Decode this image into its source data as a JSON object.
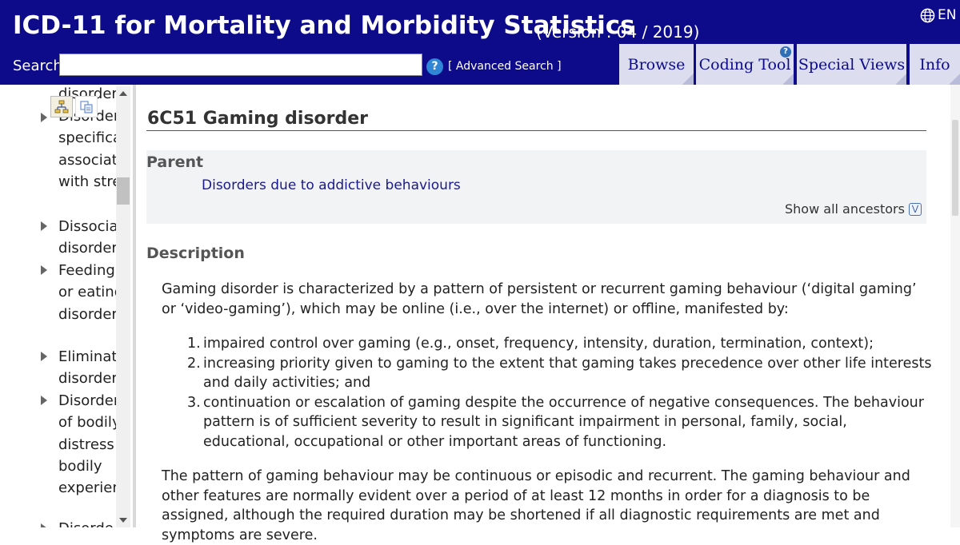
{
  "header": {
    "title": "ICD-11 for Mortality and Morbidity Statistics",
    "version": "(Version : 04 / 2019)",
    "language": "EN",
    "search_label": "Search",
    "search_value": "",
    "help_label": "?",
    "advanced_search": "[ Advanced Search ]",
    "tabs": [
      {
        "label": "Browse"
      },
      {
        "label": "Coding Tool"
      },
      {
        "label": "Special Views"
      },
      {
        "label": "Info"
      }
    ],
    "coding_tool_help": "?"
  },
  "sidebar": {
    "items": [
      {
        "lines": [
          "disorders"
        ],
        "arrow": false
      },
      {
        "lines": [
          "Disorders",
          "specifica",
          "associate",
          "with stre"
        ],
        "arrow": true
      },
      {
        "lines": [
          "Dissociat",
          "disorders"
        ],
        "arrow": true
      },
      {
        "lines": [
          "Feeding",
          "or eating",
          "disorders"
        ],
        "arrow": true
      },
      {
        "lines": [
          "Eliminati",
          "disorders"
        ],
        "arrow": true
      },
      {
        "lines": [
          "Disorders",
          "of bodily",
          "distress o",
          "bodily",
          "experien"
        ],
        "arrow": true
      },
      {
        "lines": [
          "Disorde"
        ],
        "arrow": true
      }
    ]
  },
  "entity": {
    "title": "6C51 Gaming disorder",
    "parent_label": "Parent",
    "parent_link": "Disorders due to addictive behaviours",
    "show_ancestors": "Show all ancestors",
    "description_label": "Description",
    "description_intro": "Gaming disorder is characterized by a pattern of persistent or recurrent gaming behaviour (‘digital gaming’ or ‘video-gaming’), which may be online (i.e., over the internet) or offline, manifested by:",
    "criteria": [
      {
        "num": "1.",
        "text": "impaired control over gaming (e.g., onset, frequency, intensity, duration, termination, context);"
      },
      {
        "num": "2.",
        "text": "increasing priority given to gaming to the extent that gaming takes precedence over other life interests and daily activities; and"
      },
      {
        "num": "3.",
        "text": "continuation or escalation of gaming despite the occurrence of negative consequences. The behaviour pattern is of sufficient severity to result in significant impairment in personal, family, social, educational, occupational or other important areas of functioning."
      }
    ],
    "description_followup": "The pattern of gaming behaviour may be continuous or episodic and recurrent. The gaming behaviour and other features are normally evident over a period of at least 12 months in order for a diagnosis to be assigned, although the required duration may be shortened if all diagnostic requirements are met and symptoms are severe."
  }
}
